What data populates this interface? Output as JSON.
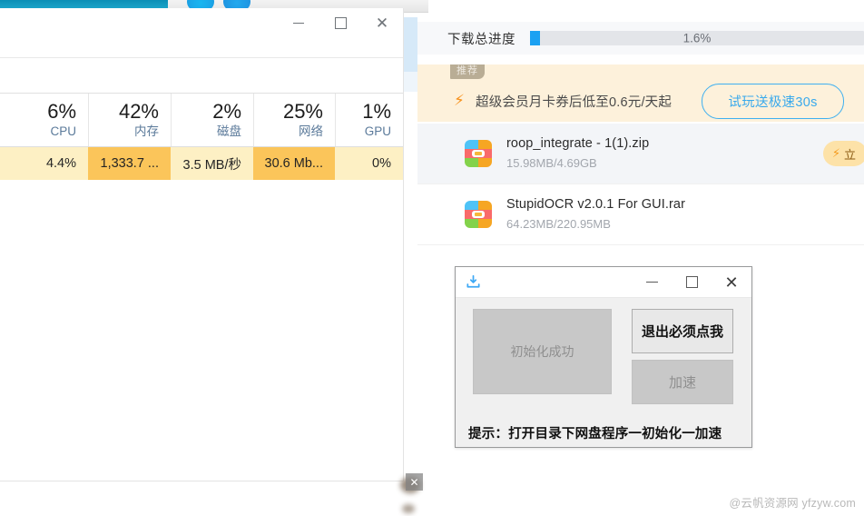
{
  "background": {
    "taskbar_color": "#0e97bd",
    "browser_strip_color": "#f1f1f1"
  },
  "task_manager": {
    "window_title": "",
    "controls": {
      "minimize": "—",
      "maximize": "□",
      "close": "✕"
    },
    "columns": [
      {
        "name": "CPU",
        "percent": "6%",
        "value": "4.4%",
        "value_highlight": "light"
      },
      {
        "name": "内存",
        "percent": "42%",
        "value": "1,333.7 ...",
        "value_highlight": "strong"
      },
      {
        "name": "磁盘",
        "percent": "2%",
        "value": "3.5 MB/秒",
        "value_highlight": "light"
      },
      {
        "name": "网络",
        "percent": "25%",
        "value": "30.6 Mb...",
        "value_highlight": "strong"
      },
      {
        "name": "GPU",
        "percent": "1%",
        "value": "0%",
        "value_highlight": "light"
      }
    ],
    "highlight_light_color": "#fdf0c4",
    "highlight_strong_color": "#fbc githubPLACEHOLDER"
  },
  "download_manager": {
    "total_progress": {
      "label": "下载总进度",
      "percent_text": "1.6%",
      "percent_value": 1.6,
      "fill_color": "#1ba1f2"
    },
    "promo": {
      "tag": "推荐",
      "icon": "bolt-icon",
      "text": "超级会员月卡券后低至0.6元/天起",
      "button_label": "试玩送极速30s",
      "button_color": "#39a9ec",
      "background": "#fdf1db"
    },
    "files": [
      {
        "name": "roop_integrate - 1(1).zip",
        "size": "15.98MB/4.69GB",
        "icon": "archive-icon",
        "selected": true,
        "action_label": "立",
        "action_icon": "bolt-icon"
      },
      {
        "name": "StupidOCR v2.0.1 For GUI.rar",
        "size": "64.23MB/220.95MB",
        "icon": "archive-icon",
        "selected": false,
        "action_label": "",
        "action_icon": ""
      }
    ]
  },
  "dialog": {
    "title_icon": "download-icon",
    "controls": {
      "minimize": "—",
      "maximize": "□",
      "close": "✕"
    },
    "status_panel": "初始化成功",
    "primary_button": "退出必须点我",
    "secondary_button": "加速",
    "hint": "提示：打开目录下网盘程序一初始化一加速"
  },
  "overlay": {
    "close_label": "✕"
  },
  "watermark": {
    "text": "@云帆资源网 yfzyw.com"
  }
}
